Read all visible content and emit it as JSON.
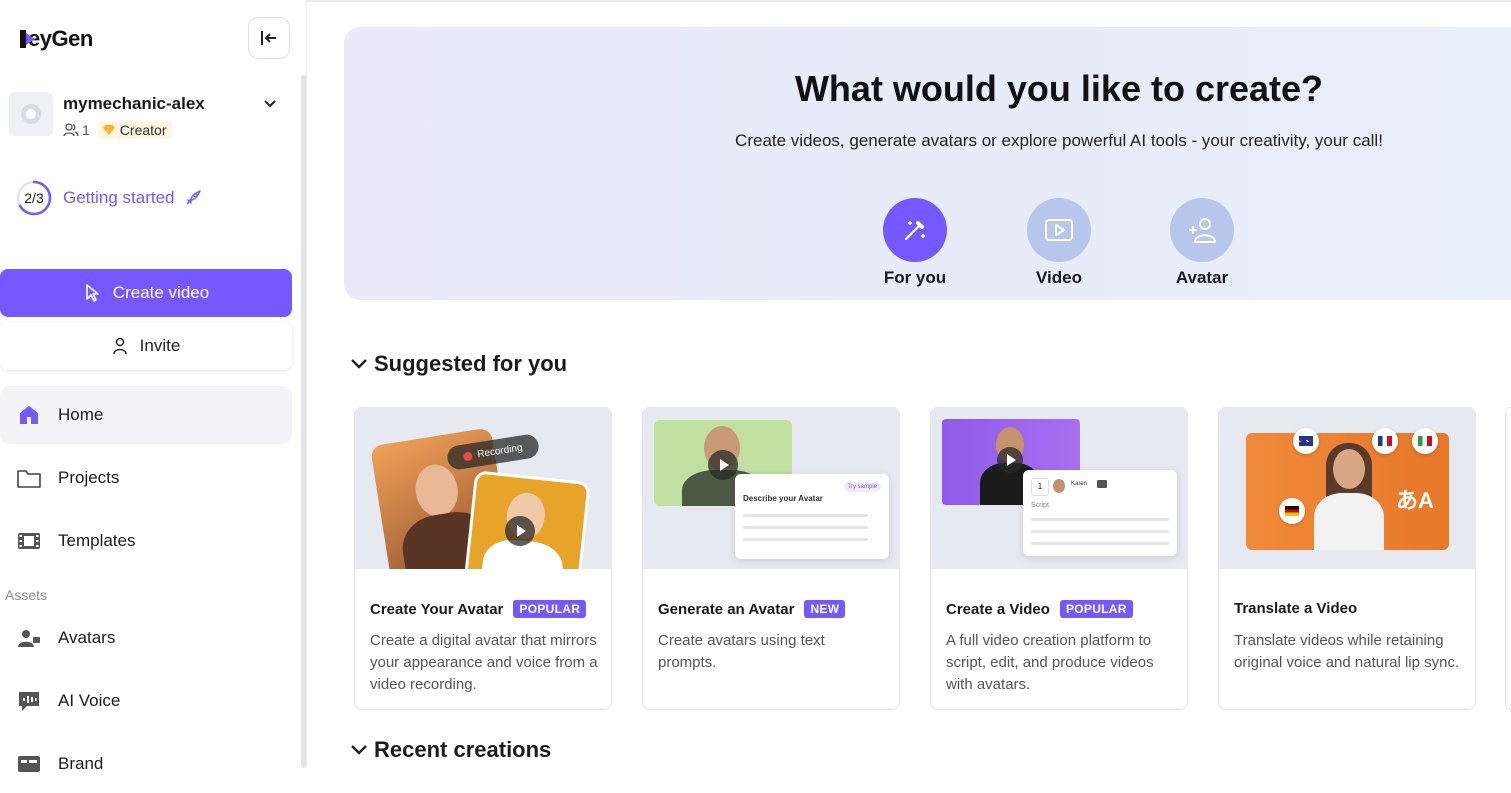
{
  "brand": {
    "logo_text": "eyGen",
    "accent": "#7559ff"
  },
  "account": {
    "name": "mymechanic-alex",
    "members": "1",
    "plan": "Creator"
  },
  "getting_started": {
    "progress": "2/3",
    "progress_fraction": 0.667,
    "label": "Getting started"
  },
  "buttons": {
    "create_video": "Create video",
    "invite": "Invite"
  },
  "nav": {
    "home": "Home",
    "projects": "Projects",
    "templates": "Templates",
    "assets_heading": "Assets",
    "avatars": "Avatars",
    "ai_voice": "AI Voice",
    "brand": "Brand"
  },
  "hero": {
    "title": "What would you like to create?",
    "subtitle": "Create videos, generate avatars or explore powerful AI tools - your creativity, your call!",
    "categories": [
      {
        "label": "For you",
        "icon": "magic-wand-icon",
        "active": true
      },
      {
        "label": "Video",
        "icon": "video-play-icon",
        "active": false
      },
      {
        "label": "Avatar",
        "icon": "add-user-icon",
        "active": false
      }
    ]
  },
  "sections": {
    "suggested": "Suggested for you",
    "recent": "Recent creations"
  },
  "cards": [
    {
      "title": "Create Your Avatar",
      "tag": "POPULAR",
      "desc": "Create a digital avatar that mirrors your appearance and voice from a video recording.",
      "thumb_text": "Recording"
    },
    {
      "title": "Generate an Avatar",
      "tag": "NEW",
      "desc": "Create avatars using text prompts.",
      "thumb_text": "Describe your Avatar",
      "thumb_chip": "Try sample"
    },
    {
      "title": "Create a Video",
      "tag": "POPULAR",
      "desc": "A full video creation platform to script, edit, and produce videos with avatars.",
      "thumb_text": "Script",
      "thumb_scene": "1",
      "thumb_name": "Karen"
    },
    {
      "title": "Translate a Video",
      "tag": "",
      "desc": "Translate videos while retaining original voice and natural lip sync.",
      "thumb_glyph": "あA"
    }
  ]
}
